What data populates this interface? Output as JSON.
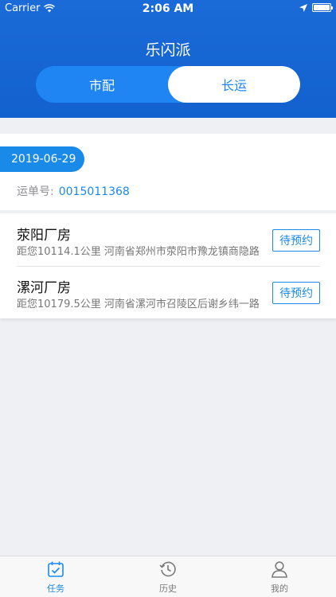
{
  "status_bar": {
    "carrier": "Carrier",
    "time": "2:06 AM"
  },
  "header": {
    "title": "乐闪派",
    "segments": [
      {
        "label": "市配",
        "selected": false
      },
      {
        "label": "长运",
        "selected": true
      }
    ]
  },
  "task": {
    "date": "2019-06-29",
    "waybill_label": "运单号:",
    "waybill_number": "0015011368"
  },
  "locations": [
    {
      "name": "荥阳厂房",
      "detail": "距您10114.1公里 河南省郑州市荥阳市豫龙镇商隐路",
      "action": "待预约"
    },
    {
      "name": "漯河厂房",
      "detail": "距您10179.5公里 河南省漯河市召陵区后谢乡纬一路",
      "action": "待预约"
    }
  ],
  "tabs": [
    {
      "label": "任务",
      "icon": "calendar-check-icon",
      "active": true
    },
    {
      "label": "历史",
      "icon": "history-clock-icon",
      "active": false
    },
    {
      "label": "我的",
      "icon": "person-icon",
      "active": false
    }
  ],
  "colors": {
    "primary": "#1a8ae8",
    "header": "#1565d6"
  }
}
